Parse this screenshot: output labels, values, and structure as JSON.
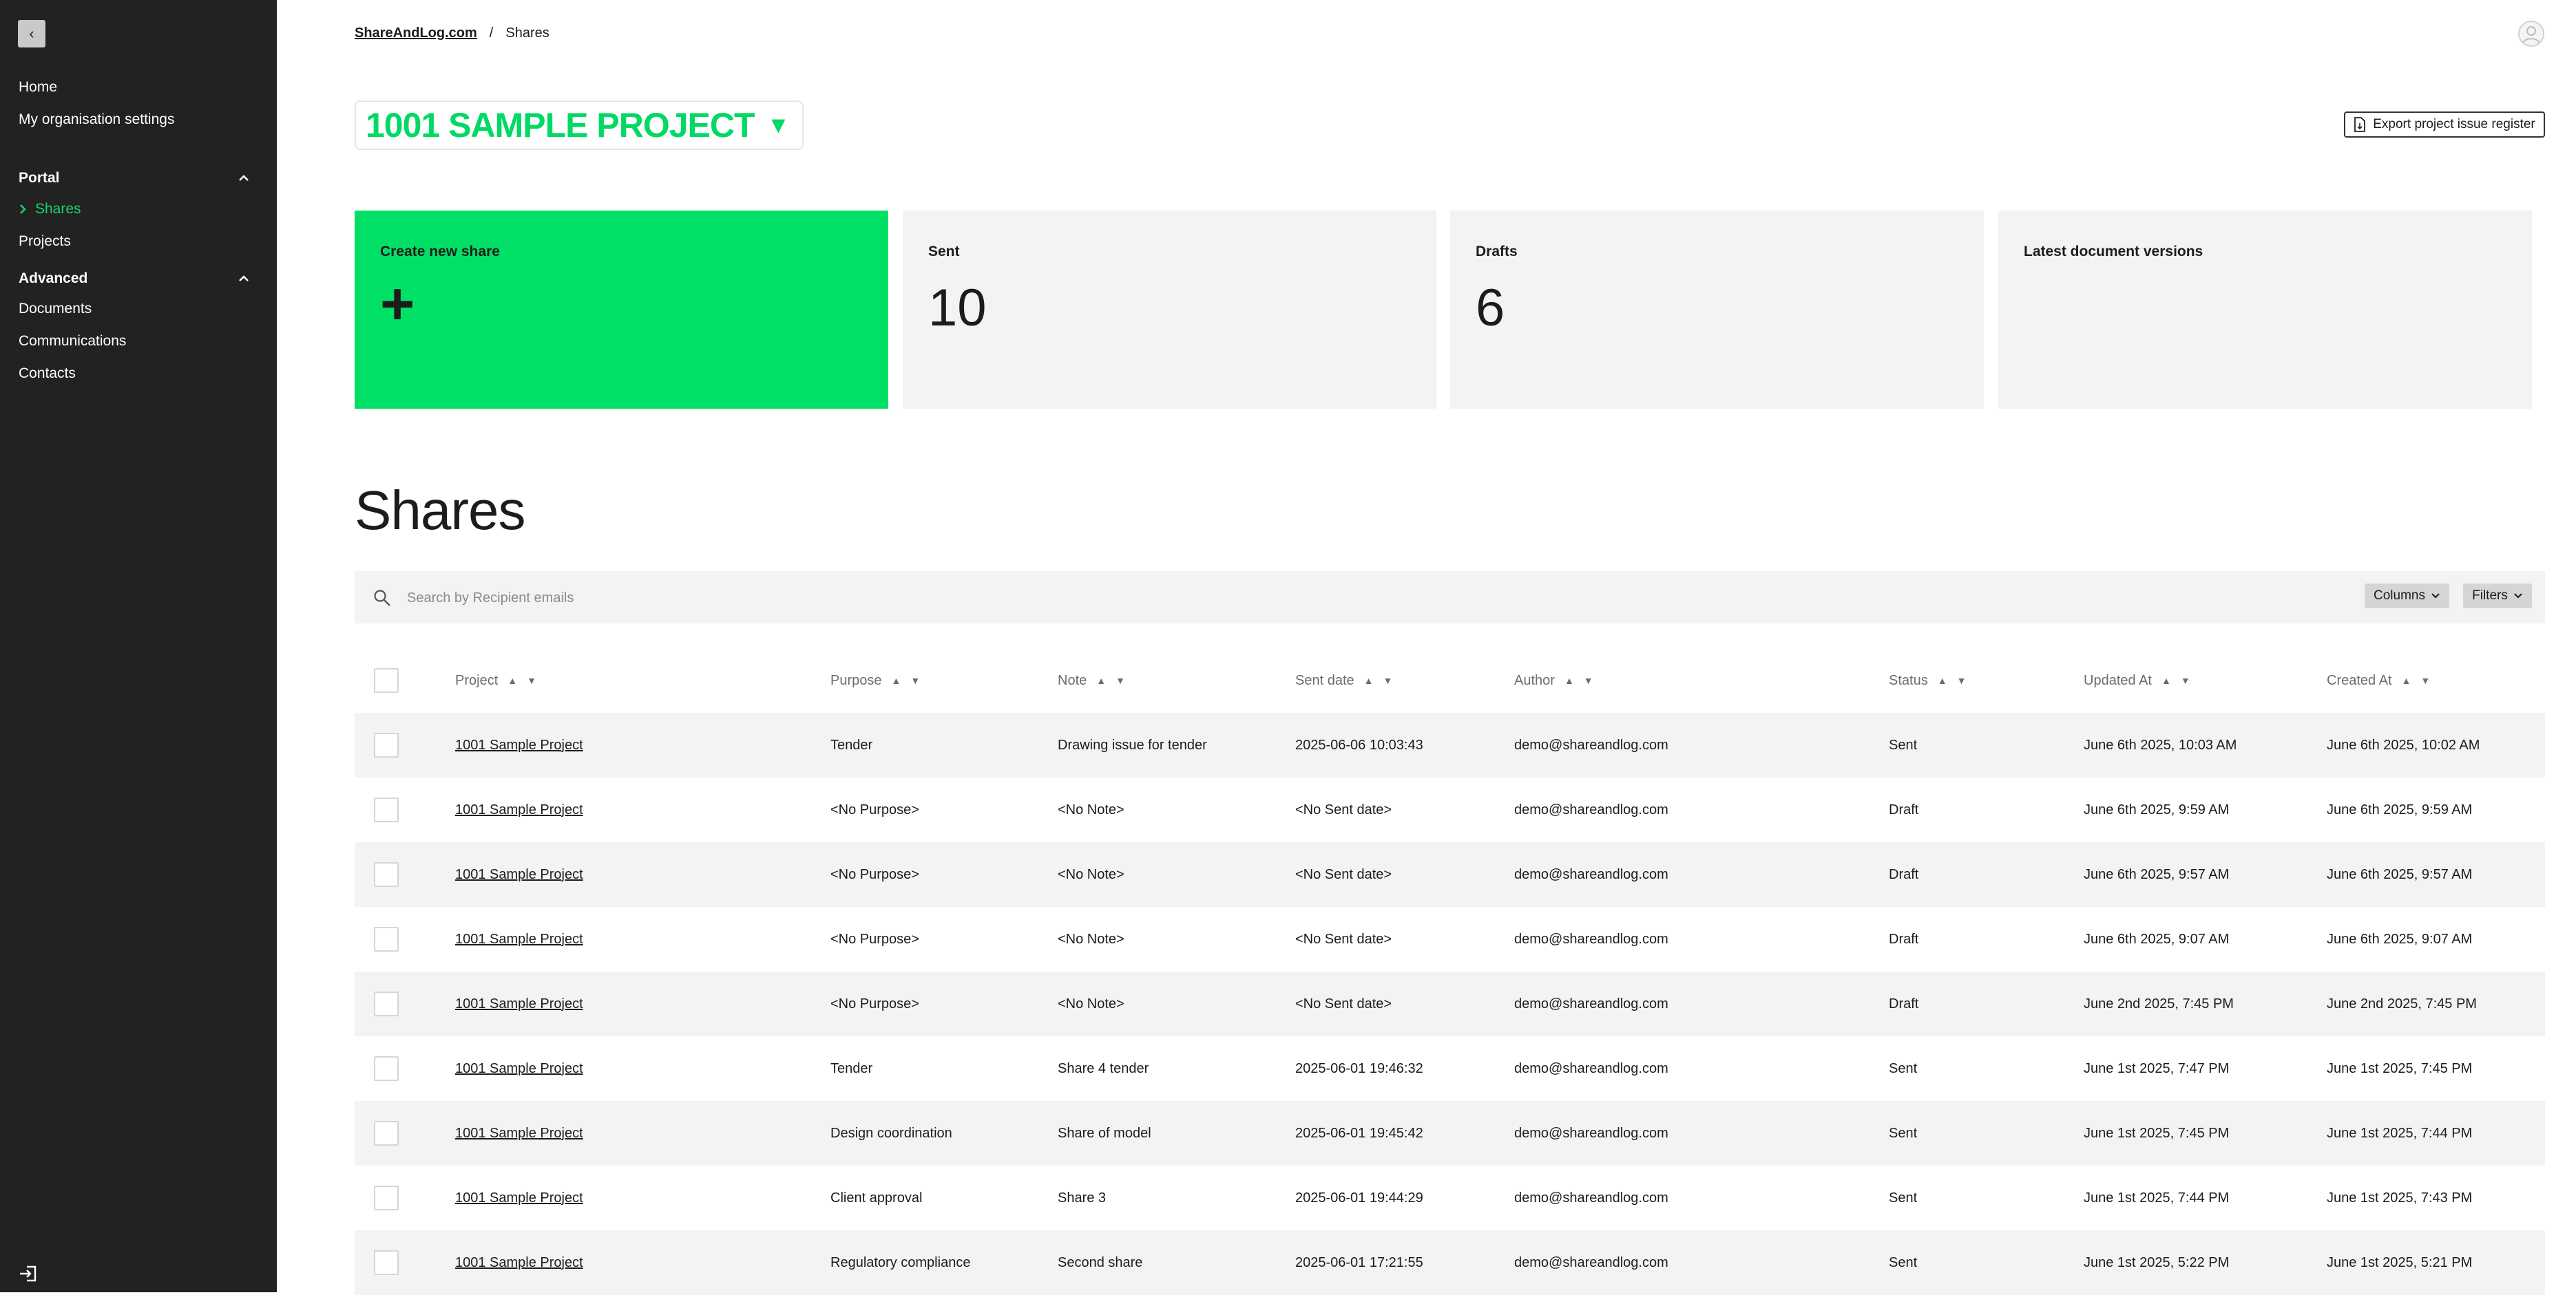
{
  "sidebar": {
    "collapse_glyph": "‹",
    "items": [
      {
        "label": "Home"
      },
      {
        "label": "My organisation settings"
      }
    ],
    "sections": [
      {
        "label": "Portal",
        "items": [
          {
            "label": "Shares",
            "active": true
          },
          {
            "label": "Projects"
          }
        ]
      },
      {
        "label": "Advanced",
        "items": [
          {
            "label": "Documents"
          },
          {
            "label": "Communications"
          },
          {
            "label": "Contacts"
          }
        ]
      }
    ],
    "logout_icon": "logout-icon"
  },
  "breadcrumb": {
    "root": "ShareAndLog.com",
    "separator": "/",
    "current": "Shares"
  },
  "project_selector": {
    "label": "1001 SAMPLE PROJECT",
    "caret": "▼"
  },
  "export_button": {
    "label": "Export project issue register"
  },
  "cards": {
    "create": {
      "label": "Create new share",
      "symbol": "+"
    },
    "sent": {
      "label": "Sent",
      "value": "10"
    },
    "drafts": {
      "label": "Drafts",
      "value": "6"
    },
    "latest": {
      "label": "Latest document versions"
    }
  },
  "shares": {
    "title": "Shares",
    "search_placeholder": "Search by Recipient emails",
    "columns_button": "Columns",
    "filters_button": "Filters",
    "headers": [
      "Project",
      "Purpose",
      "Note",
      "Sent date",
      "Author",
      "Status",
      "Updated At",
      "Created At"
    ],
    "rows": [
      [
        "1001 Sample Project",
        "Tender",
        "Drawing issue for tender",
        "2025-06-06 10:03:43",
        "demo@shareandlog.com",
        "Sent",
        "June 6th 2025, 10:03 AM",
        "June 6th 2025, 10:02 AM"
      ],
      [
        "1001 Sample Project",
        "<No Purpose>",
        "<No Note>",
        "<No Sent date>",
        "demo@shareandlog.com",
        "Draft",
        "June 6th 2025, 9:59 AM",
        "June 6th 2025, 9:59 AM"
      ],
      [
        "1001 Sample Project",
        "<No Purpose>",
        "<No Note>",
        "<No Sent date>",
        "demo@shareandlog.com",
        "Draft",
        "June 6th 2025, 9:57 AM",
        "June 6th 2025, 9:57 AM"
      ],
      [
        "1001 Sample Project",
        "<No Purpose>",
        "<No Note>",
        "<No Sent date>",
        "demo@shareandlog.com",
        "Draft",
        "June 6th 2025, 9:07 AM",
        "June 6th 2025, 9:07 AM"
      ],
      [
        "1001 Sample Project",
        "<No Purpose>",
        "<No Note>",
        "<No Sent date>",
        "demo@shareandlog.com",
        "Draft",
        "June 2nd 2025, 7:45 PM",
        "June 2nd 2025, 7:45 PM"
      ],
      [
        "1001 Sample Project",
        "Tender",
        "Share 4 tender",
        "2025-06-01 19:46:32",
        "demo@shareandlog.com",
        "Sent",
        "June 1st 2025, 7:47 PM",
        "June 1st 2025, 7:45 PM"
      ],
      [
        "1001 Sample Project",
        "Design coordination",
        "Share of model",
        "2025-06-01 19:45:42",
        "demo@shareandlog.com",
        "Sent",
        "June 1st 2025, 7:45 PM",
        "June 1st 2025, 7:44 PM"
      ],
      [
        "1001 Sample Project",
        "Client approval",
        "Share 3",
        "2025-06-01 19:44:29",
        "demo@shareandlog.com",
        "Sent",
        "June 1st 2025, 7:44 PM",
        "June 1st 2025, 7:43 PM"
      ],
      [
        "1001 Sample Project",
        "Regulatory compliance",
        "Second share",
        "2025-06-01 17:21:55",
        "demo@shareandlog.com",
        "Sent",
        "June 1st 2025, 5:22 PM",
        "June 1st 2025, 5:21 PM"
      ]
    ]
  },
  "colors": {
    "accent": "#00e067",
    "accent_text": "#19d46a",
    "sidebar_bg": "#222222",
    "card_bg": "#f3f3f3"
  }
}
